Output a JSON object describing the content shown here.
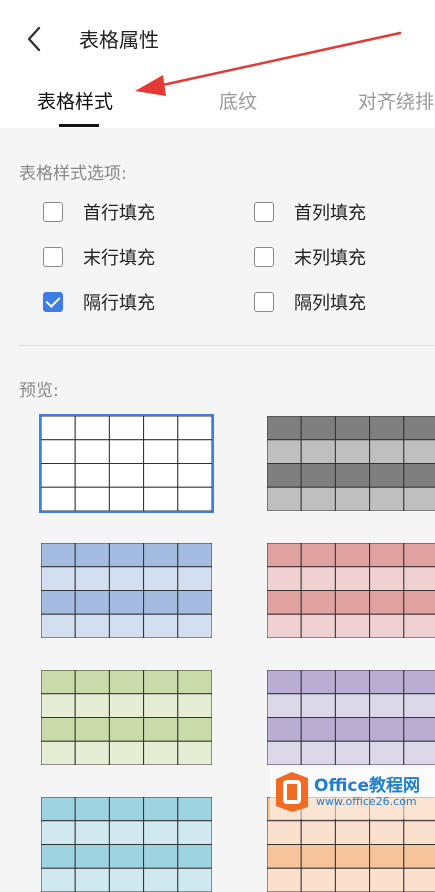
{
  "header": {
    "title": "表格属性",
    "back_icon": "chevron-left-icon"
  },
  "tabs": [
    {
      "label": "表格样式",
      "active": true
    },
    {
      "label": "底纹",
      "active": false
    },
    {
      "label": "对齐绕排",
      "active": false
    }
  ],
  "style_options": {
    "label": "表格样式选项:",
    "items": [
      {
        "label": "首行填充",
        "checked": false
      },
      {
        "label": "首列填充",
        "checked": false
      },
      {
        "label": "末行填充",
        "checked": false
      },
      {
        "label": "末列填充",
        "checked": false
      },
      {
        "label": "隔行填充",
        "checked": true
      },
      {
        "label": "隔列填充",
        "checked": false
      }
    ]
  },
  "preview": {
    "label": "预览:",
    "styles": [
      {
        "name": "plain",
        "band": "#ffffff",
        "light": "#ffffff",
        "selected": true
      },
      {
        "name": "gray",
        "band": "#7f7f7f",
        "light": "#bfbfbf",
        "selected": false
      },
      {
        "name": "blue",
        "band": "#a3bce0",
        "light": "#d3dff0",
        "selected": false
      },
      {
        "name": "red",
        "band": "#dfa2a1",
        "light": "#f0d1d1",
        "selected": false
      },
      {
        "name": "green",
        "band": "#c9dba9",
        "light": "#e5eed5",
        "selected": false
      },
      {
        "name": "purple",
        "band": "#b9aed2",
        "light": "#dcd7e9",
        "selected": false
      },
      {
        "name": "teal",
        "band": "#9ed3e2",
        "light": "#d0e9f0",
        "selected": false
      },
      {
        "name": "orange",
        "band": "#f7c39a",
        "light": "#fbe1cd",
        "selected": false
      }
    ]
  },
  "colors": {
    "accent": "#3d7ee6",
    "arrow": "#e53935",
    "watermark": "#1f7fd0",
    "watermark_logo": "#f26b22"
  },
  "watermark": {
    "brand": "Office教程网",
    "url": "www.office26.com"
  }
}
